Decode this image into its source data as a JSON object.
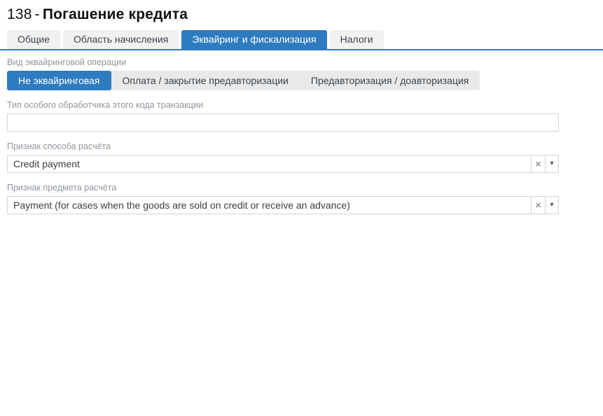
{
  "header": {
    "code": "138",
    "separator": "-",
    "name": "Погашение кредита"
  },
  "tabs": [
    {
      "label": "Общие",
      "active": false
    },
    {
      "label": "Область начисления",
      "active": false
    },
    {
      "label": "Эквайринг и фискализация",
      "active": true
    },
    {
      "label": "Налоги",
      "active": false
    }
  ],
  "form": {
    "acquiring_type": {
      "label": "Вид эквайринговой операции",
      "options": [
        "Не эквайринговая",
        "Оплата / закрытие предавторизации",
        "Предавторизация / доавторизация"
      ],
      "selected": "Не эквайринговая"
    },
    "special_handler": {
      "label": "Тип особого обработчика этого кода транзакции",
      "value": ""
    },
    "payment_method": {
      "label": "Признак способа расчёта",
      "value": "Credit payment"
    },
    "payment_subject": {
      "label": "Признак предмета расчёта",
      "value": "Payment (for cases when the goods are sold on credit or receive an advance)"
    }
  },
  "icons": {
    "clear": "×",
    "caret": "▾"
  },
  "colors": {
    "accent": "#2e7bbf",
    "tab_inactive_bg": "#f1f1f1",
    "segment_bg": "#e9e9e9",
    "label_text": "#8f969e",
    "border": "#d4d4d4"
  }
}
